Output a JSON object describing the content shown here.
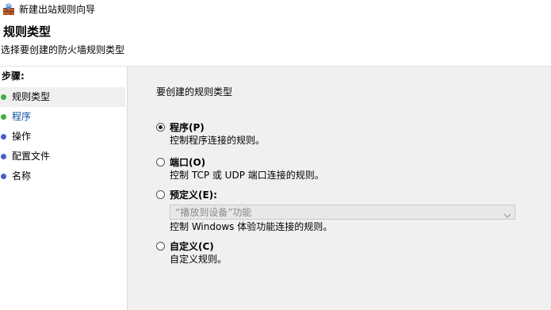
{
  "window": {
    "title": "新建出站规则向导"
  },
  "header": {
    "title": "规则类型",
    "subtitle": "选择要创建的防火墙规则类型"
  },
  "sidebar": {
    "steps_label": "步骤:",
    "steps": [
      {
        "label": "规则类型",
        "dot_color": "#3fae3f"
      },
      {
        "label": "程序",
        "dot_color": "#3fae3f"
      },
      {
        "label": "操作",
        "dot_color": "#4a5bd0"
      },
      {
        "label": "配置文件",
        "dot_color": "#4a5bd0"
      },
      {
        "label": "名称",
        "dot_color": "#4a5bd0"
      }
    ]
  },
  "main": {
    "question": "要创建的规则类型",
    "options": [
      {
        "label": "程序(P)",
        "desc": "控制程序连接的规则。",
        "checked": true
      },
      {
        "label": "端口(O)",
        "desc": "控制 TCP 或 UDP 端口连接的规则。",
        "checked": false
      },
      {
        "label": "预定义(E):",
        "desc": "控制 Windows 体验功能连接的规则。",
        "checked": false,
        "dropdown_value": "“播放到设备”功能"
      },
      {
        "label": "自定义(C)",
        "desc": "自定义规则。",
        "checked": false
      }
    ]
  }
}
